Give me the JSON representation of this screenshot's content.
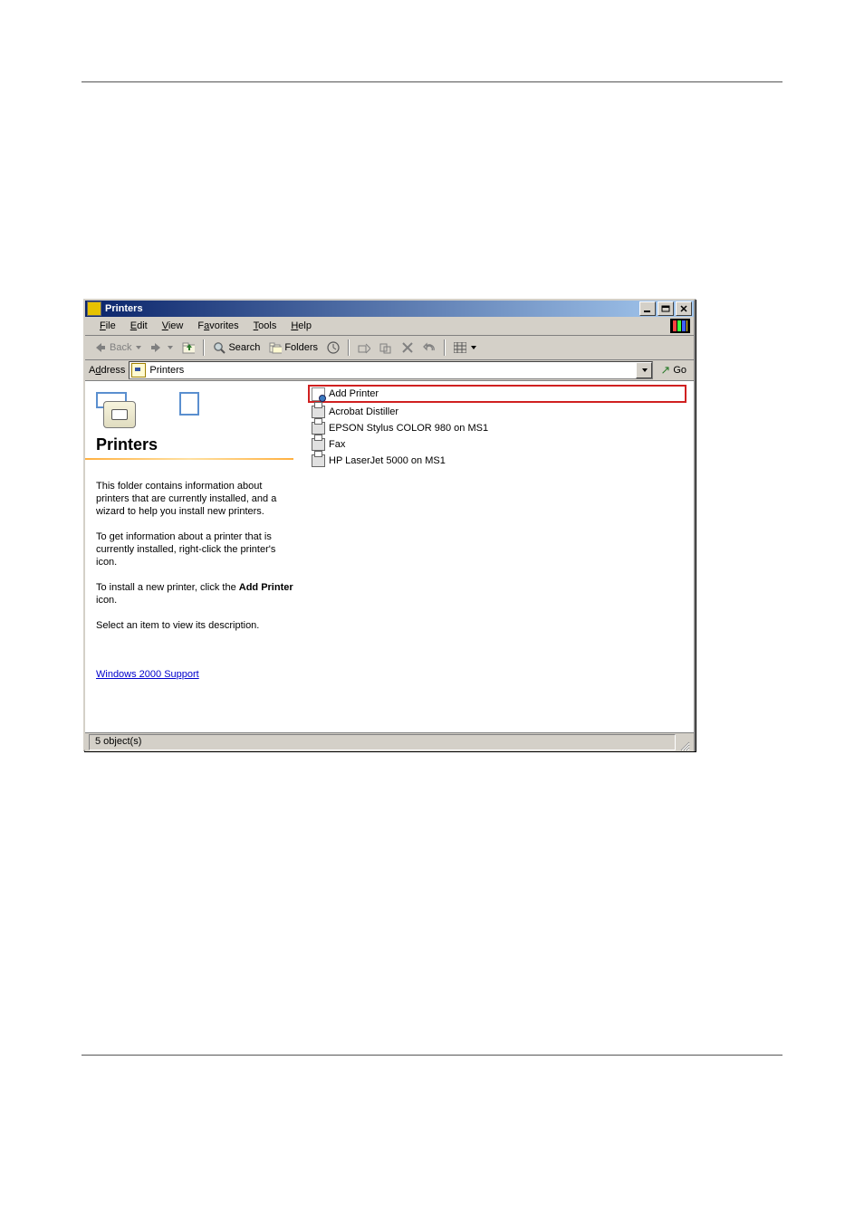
{
  "titlebar": {
    "title": "Printers"
  },
  "menubar": {
    "file": "File",
    "edit": "Edit",
    "view": "View",
    "favorites": "Favorites",
    "tools": "Tools",
    "help": "Help"
  },
  "toolbar": {
    "back": "Back",
    "search": "Search",
    "folders": "Folders"
  },
  "addressbar": {
    "label": "Address",
    "value": "Printers",
    "go": "Go"
  },
  "leftpanel": {
    "heading": "Printers",
    "para1": "This folder contains information about printers that are currently installed, and a wizard to help you install new printers.",
    "para2": "To get information about a printer that is currently installed, right-click the printer's icon.",
    "para3a": "To install a new printer, click the ",
    "para3b": "Add Printer",
    "para3c": " icon.",
    "para4": "Select an item to view its description.",
    "link": "Windows 2000 Support"
  },
  "files": [
    {
      "name": "Add Printer",
      "icon": "add"
    },
    {
      "name": "Acrobat Distiller",
      "icon": "printer"
    },
    {
      "name": "EPSON Stylus COLOR 980 on MS1",
      "icon": "printer"
    },
    {
      "name": "Fax",
      "icon": "printer"
    },
    {
      "name": "HP LaserJet 5000 on MS1",
      "icon": "printer"
    }
  ],
  "statusbar": {
    "text": "5 object(s)"
  }
}
